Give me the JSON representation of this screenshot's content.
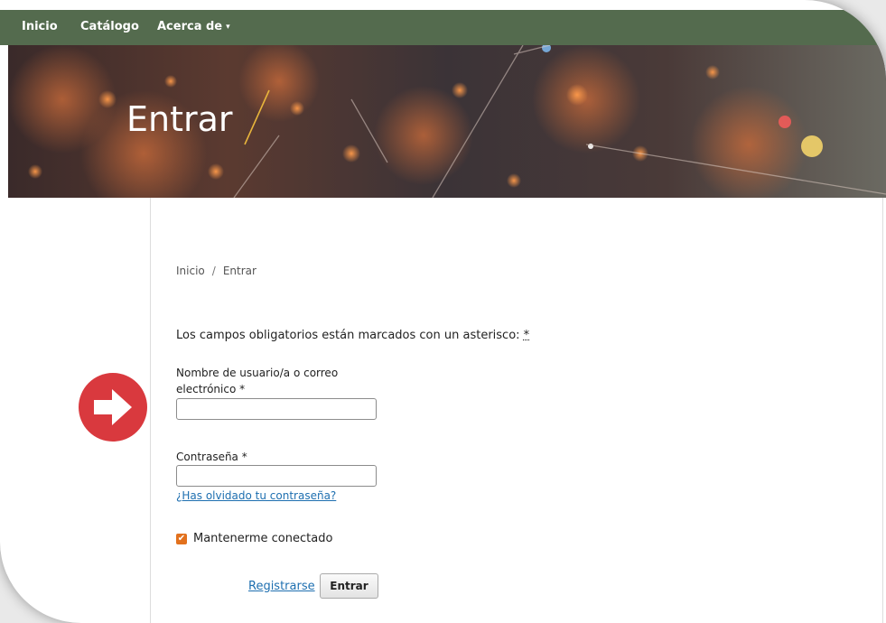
{
  "nav": {
    "items": [
      "Inicio",
      "Catálogo",
      "Acerca de"
    ],
    "dropdown_caret": "▾"
  },
  "banner": {
    "title": "Entrar"
  },
  "breadcrumb": {
    "home": "Inicio",
    "separator": "/",
    "current": "Entrar"
  },
  "form": {
    "required_note": "Los campos obligatorios están marcados con un asterisco:",
    "required_symbol": "*",
    "username_label": "Nombre de usuario/a o correo electrónico *",
    "username_value": "",
    "password_label": "Contraseña *",
    "password_value": "",
    "forgot_link": "¿Has olvidado tu contraseña?",
    "remember_label": "Mantenerme conectado",
    "remember_checked": true,
    "register_link": "Registrarse",
    "submit_label": "Entrar"
  },
  "colors": {
    "navbar": "#546b4e",
    "link": "#1e6fb0",
    "checkbox": "#e2711d",
    "arrow_badge": "#d9393e"
  },
  "icons": {
    "remember_check": "check-icon",
    "annotation": "right-arrow-icon"
  }
}
